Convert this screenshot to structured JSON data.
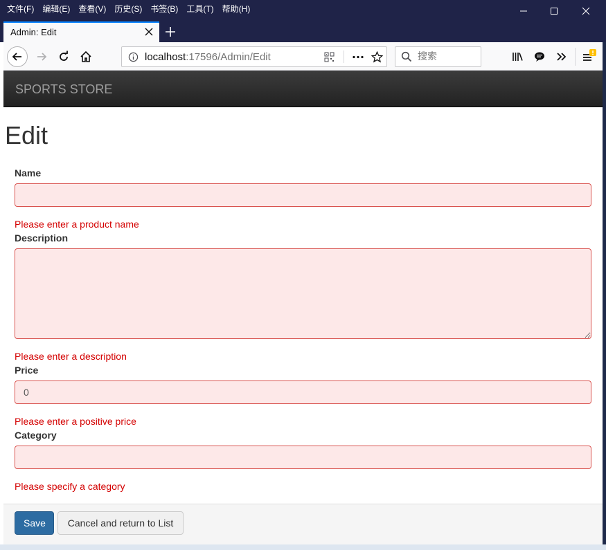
{
  "menu": [
    "文件(F)",
    "编辑(E)",
    "查看(V)",
    "历史(S)",
    "书签(B)",
    "工具(T)",
    "帮助(H)"
  ],
  "tab": {
    "title": "Admin: Edit"
  },
  "urlbar": {
    "host": "localhost",
    "rest": ":17596/Admin/Edit"
  },
  "search": {
    "placeholder": "搜索"
  },
  "navbar": {
    "brand": "SPORTS STORE"
  },
  "page": {
    "title": "Edit"
  },
  "form": {
    "name": {
      "label": "Name",
      "value": "",
      "error": "Please enter a product name"
    },
    "description": {
      "label": "Description",
      "value": "",
      "error": "Please enter a description"
    },
    "price": {
      "label": "Price",
      "value": "0",
      "error": "Please enter a positive price"
    },
    "category": {
      "label": "Category",
      "value": "",
      "error": "Please specify a category"
    }
  },
  "buttons": {
    "save": "Save",
    "cancel": "Cancel and return to List"
  },
  "colors": {
    "error": "#d40000",
    "field_bg": "#fde8e8",
    "primary": "#2d6ca2",
    "accent": "#0a84ff"
  }
}
